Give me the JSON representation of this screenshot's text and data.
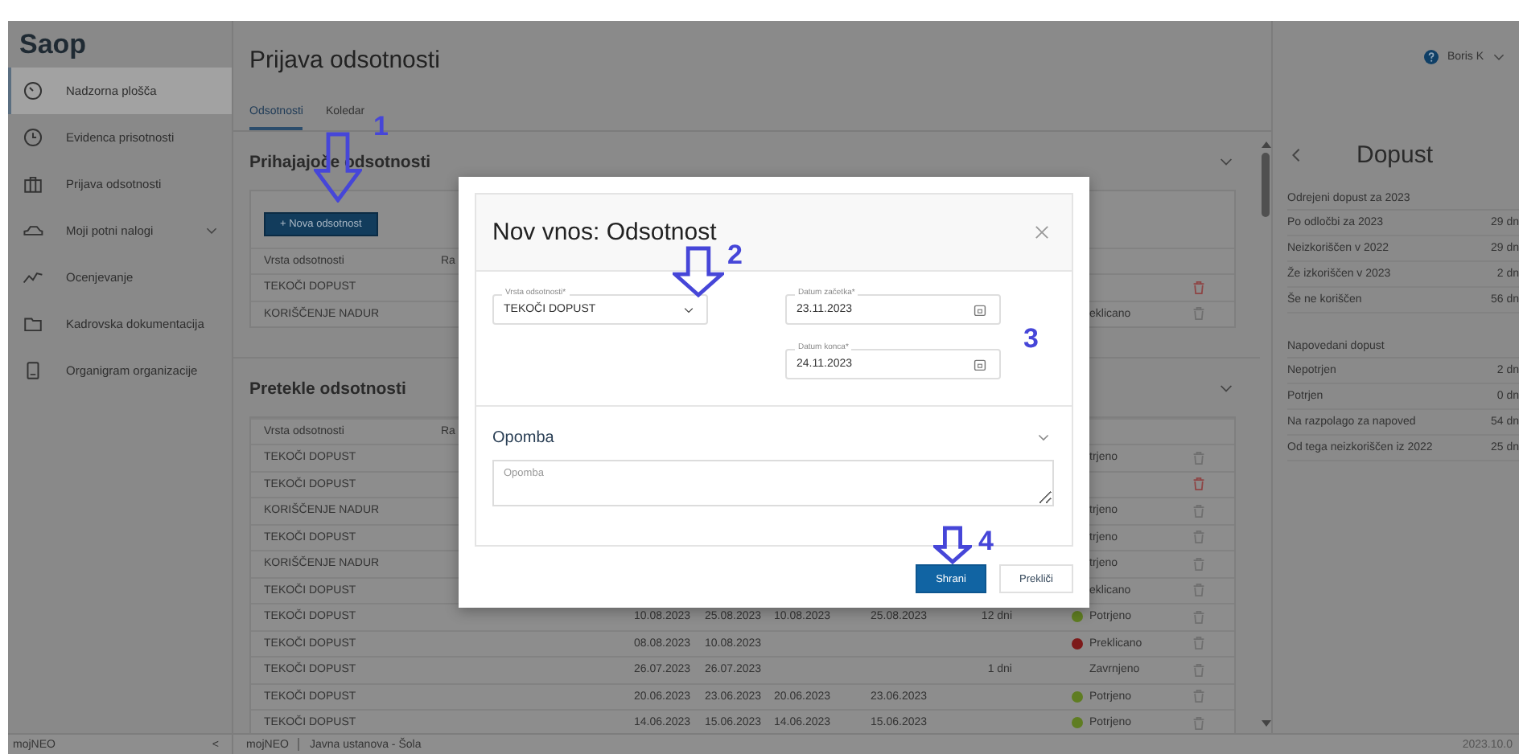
{
  "sidebar": {
    "logo": "Saop",
    "items": [
      {
        "label": "Nadzorna plošča",
        "kind": "link",
        "selected": true
      },
      {
        "label": "Evidenca prisotnosti",
        "kind": "link",
        "selected": false
      },
      {
        "label": "Prijava odsotnosti",
        "kind": "link",
        "selected": false
      },
      {
        "label": "Moji potni nalogi",
        "kind": "group",
        "selected": false
      },
      {
        "label": "Ocenjevanje",
        "kind": "link",
        "selected": false
      },
      {
        "label": "Kadrovska dokumentacija",
        "kind": "link",
        "selected": false
      },
      {
        "label": "Organigram organizacije",
        "kind": "link",
        "selected": false
      }
    ],
    "footer": {
      "label": "mojNEO",
      "collapse": "<"
    }
  },
  "header": {
    "title": "Prijava odsotnosti",
    "user": "Boris K"
  },
  "tabs": [
    {
      "label": "Odsotnosti",
      "selected": true
    },
    {
      "label": "Koledar",
      "selected": false
    }
  ],
  "upcoming": {
    "title": "Prihajajoče odsotnosti",
    "expanded": true,
    "add_button": "+ Nova odsotnost",
    "columns": [
      "Vrsta odsotnosti",
      "Ra"
    ],
    "rows": [
      {
        "type": "TEKOČI DOPUST",
        "highlighted": true
      },
      {
        "type": "KORIŠČENJE NADUR",
        "status": {
          "text": "eklicano"
        },
        "highlighted": false
      }
    ]
  },
  "past": {
    "title": "Pretekle odsotnosti",
    "expanded": true,
    "columns": [
      "Vrsta odsotnosti",
      "Ra"
    ],
    "rows": [
      {
        "type": "TEKOČI DOPUST",
        "status": {
          "text": "trjeno"
        },
        "highlighted": false
      },
      {
        "type": "TEKOČI DOPUST",
        "highlighted": true
      },
      {
        "type": "KORIŠČENJE NADUR",
        "status": {
          "text": "trjeno"
        },
        "highlighted": false
      },
      {
        "type": "TEKOČI DOPUST",
        "status": {
          "text": "trjeno"
        },
        "highlighted": false
      },
      {
        "type": "KORIŠČENJE NADUR",
        "status": {
          "text": "trjeno"
        },
        "highlighted": false
      },
      {
        "type": "TEKOČI DOPUST",
        "status": {
          "text": "eklicano"
        },
        "highlighted": false
      },
      {
        "type": "TEKOČI DOPUST",
        "column_3": "10.08.2023",
        "column_4": "25.08.2023",
        "column_5": "10.08.2023",
        "column_6": "25.08.2023",
        "column_7": "12 dni",
        "status": {
          "text": "Potrjeno",
          "color": "#5f7d22"
        },
        "highlighted": false
      },
      {
        "type": "TEKOČI DOPUST",
        "column_3": "08.08.2023",
        "column_4": "10.08.2023",
        "status": {
          "text": "Preklicano",
          "color": "#7d1a1a"
        },
        "highlighted": false
      },
      {
        "type": "TEKOČI DOPUST",
        "column_3": "26.07.2023",
        "column_4": "26.07.2023",
        "column_7": "1 dni",
        "status": {
          "text": "Zavrnjeno"
        },
        "highlighted": false
      },
      {
        "type": "TEKOČI DOPUST",
        "column_3": "20.06.2023",
        "column_4": "23.06.2023",
        "column_5": "20.06.2023",
        "column_6": "23.06.2023",
        "status": {
          "text": "Potrjeno",
          "color": "#5f7d22"
        },
        "highlighted": false
      },
      {
        "type": "TEKOČI DOPUST",
        "column_3": "14.06.2023",
        "column_4": "15.06.2023",
        "column_5": "14.06.2023",
        "column_6": "15.06.2023",
        "status": {
          "text": "Potrjeno",
          "color": "#5f7d22"
        },
        "highlighted": false
      }
    ]
  },
  "leave_panel": {
    "title": "Dopust",
    "sections": [
      {
        "heading": "Odrejeni dopust za 2023",
        "rows": [
          {
            "label": "Po odločbi za 2023",
            "value": "29 dn"
          },
          {
            "label": "Neizkoriščen v 2022",
            "value": "29 dn"
          },
          {
            "label": "Že izkoriščen v 2023",
            "value": "2 dn"
          },
          {
            "label": "Še ne koriščen",
            "value": "56 dn"
          }
        ]
      },
      {
        "heading": "Napovedani dopust",
        "rows": [
          {
            "label": "Nepotrjen",
            "value": "2 dn"
          },
          {
            "label": "Potrjen",
            "value": "0 dn"
          },
          {
            "label": "Na razpolago za napoved",
            "value": "54 dn"
          },
          {
            "label": "Od tega neizkoriščen iz 2022",
            "value": "25 dn"
          }
        ]
      }
    ]
  },
  "status_bar": {
    "app": "mojNEO",
    "organization": "Javna ustanova - Šola",
    "version": "2023.10.0"
  },
  "dialog": {
    "title": "Nov vnos: Odsotnost",
    "fields": [
      {
        "kind": "select",
        "label": "Vrsta odsotnosti*",
        "value": "TEKOČI DOPUST"
      },
      {
        "kind": "date",
        "label": "Datum začetka*",
        "value": "23.11.2023"
      },
      {
        "kind": "date",
        "label": "Datum konca*",
        "value": "24.11.2023"
      }
    ],
    "note": {
      "title": "Opomba",
      "expanded": true,
      "placeholder": "Opomba"
    },
    "buttons": [
      {
        "label": "Shrani",
        "kind": "primary"
      },
      {
        "label": "Prekliči",
        "kind": "secondary"
      }
    ]
  },
  "annotations": [
    {
      "label": "1",
      "kind": "arrow"
    },
    {
      "label": "2",
      "kind": "arrow"
    },
    {
      "label": "3",
      "kind": "number"
    },
    {
      "label": "4",
      "kind": "arrow"
    }
  ]
}
